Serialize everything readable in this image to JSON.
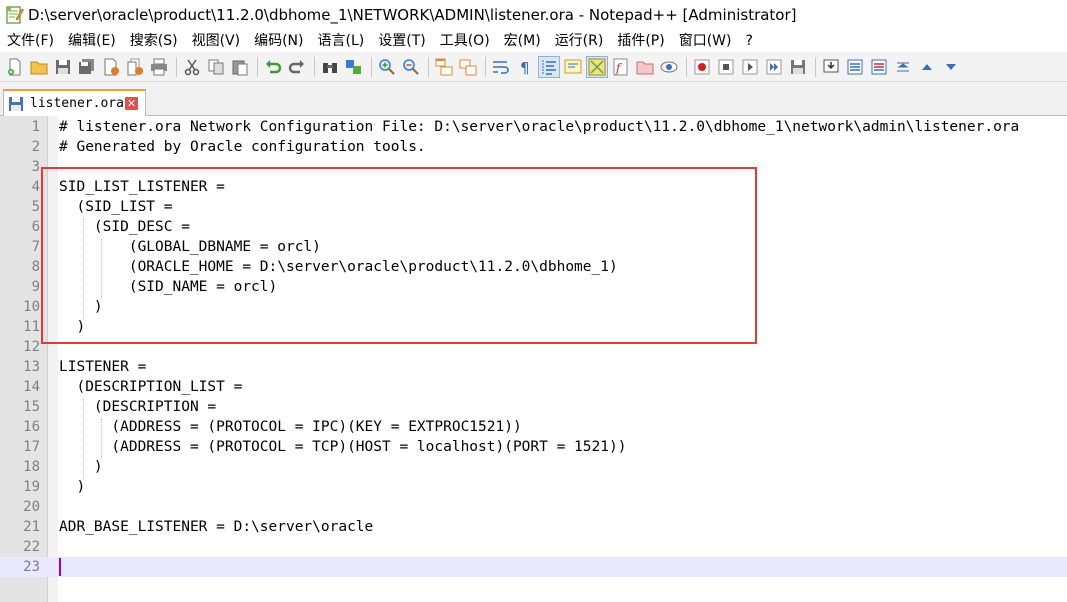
{
  "window": {
    "title": "D:\\server\\oracle\\product\\11.2.0\\dbhome_1\\NETWORK\\ADMIN\\listener.ora - Notepad++ [Administrator]"
  },
  "menu": [
    "文件(F)",
    "编辑(E)",
    "搜索(S)",
    "视图(V)",
    "编码(N)",
    "语言(L)",
    "设置(T)",
    "工具(O)",
    "宏(M)",
    "运行(R)",
    "插件(P)",
    "窗口(W)",
    "?"
  ],
  "tab": {
    "label": "listener.ora"
  },
  "editor": {
    "lines": [
      "# listener.ora Network Configuration File: D:\\server\\oracle\\product\\11.2.0\\dbhome_1\\network\\admin\\listener.ora",
      "# Generated by Oracle configuration tools.",
      "",
      "SID_LIST_LISTENER =",
      "  (SID_LIST =",
      "    (SID_DESC =",
      "        (GLOBAL_DBNAME = orcl)",
      "        (ORACLE_HOME = D:\\server\\oracle\\product\\11.2.0\\dbhome_1)",
      "        (SID_NAME = orcl)",
      "    )",
      "  )",
      "",
      "LISTENER =",
      "  (DESCRIPTION_LIST =",
      "    (DESCRIPTION =",
      "      (ADDRESS = (PROTOCOL = IPC)(KEY = EXTPROC1521))",
      "      (ADDRESS = (PROTOCOL = TCP)(HOST = localhost)(PORT = 1521))",
      "    )",
      "  )",
      "",
      "ADR_BASE_LISTENER = D:\\server\\oracle",
      "",
      ""
    ],
    "current_line": 23
  },
  "colors": {
    "highlight_box": "#e53935",
    "tab_accent": "#f59b3f",
    "current_line_bg": "#e8e8ff"
  }
}
